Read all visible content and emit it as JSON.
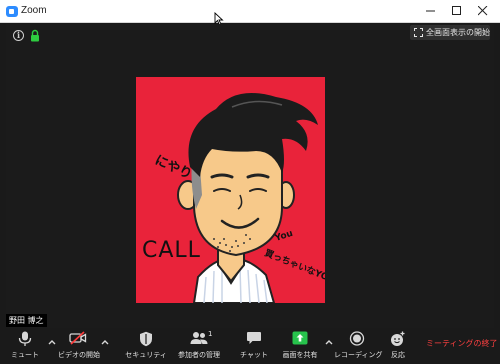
{
  "window": {
    "title": "Zoom"
  },
  "meeting": {
    "fullscreen_label": "全画面表示の開始",
    "participant_name": "野田 博之",
    "avatar_text": {
      "left": "にやり",
      "call": "CALL",
      "you": "You",
      "right": "買っちゃいなYO!"
    }
  },
  "toolbar": {
    "mute_label": "ミュート",
    "video_label": "ビデオの開始",
    "security_label": "セキュリティ",
    "participants_label": "参加者の管理",
    "participants_count": "1",
    "chat_label": "チャット",
    "share_label": "画面を共有",
    "record_label": "レコーディング",
    "reactions_label": "反応",
    "end_label": "ミーティングの終了"
  },
  "colors": {
    "tile_background": "#e9233a",
    "share_green": "#27c24c",
    "end_red": "#ff4040",
    "zoom_blue": "#2d8cff"
  }
}
